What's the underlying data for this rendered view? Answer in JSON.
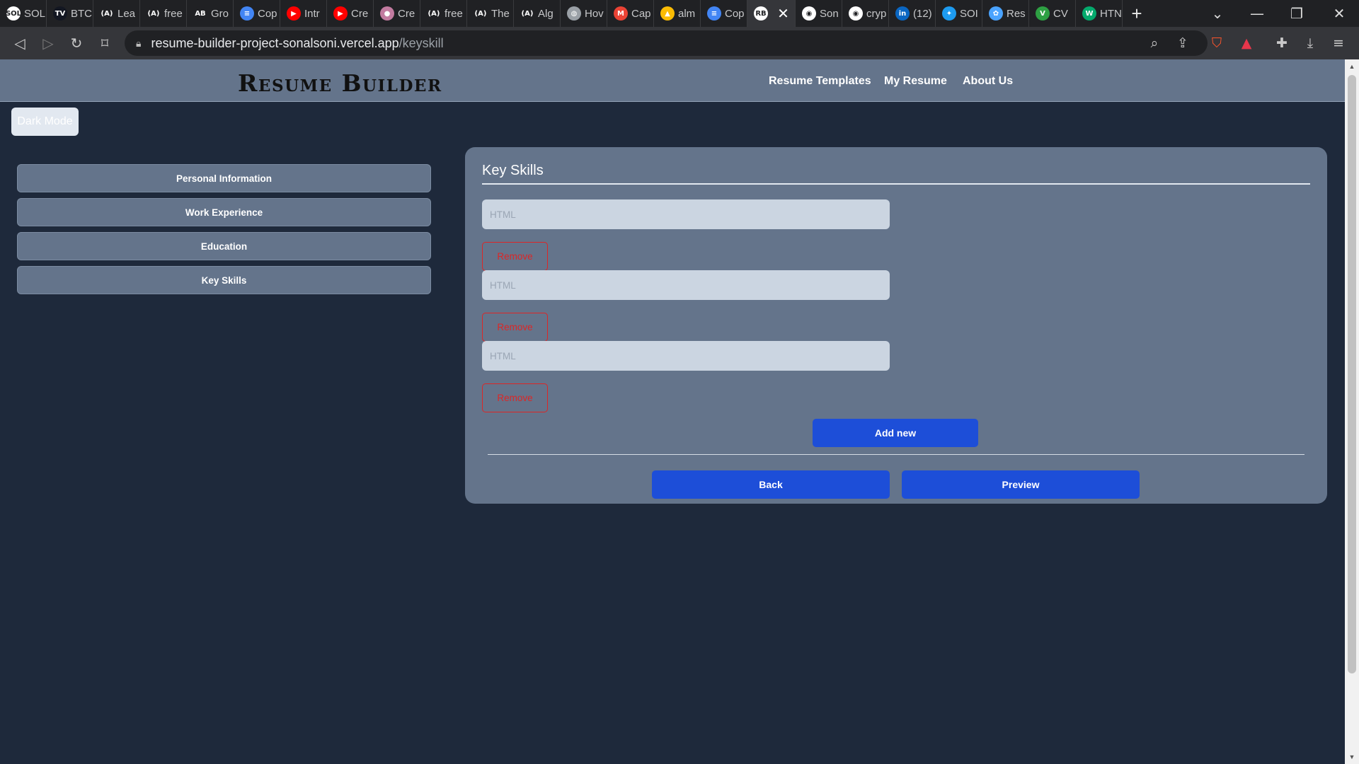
{
  "browser": {
    "tabs": [
      {
        "label": "SOL",
        "icon": "SOL",
        "color": "#ffffff"
      },
      {
        "label": "BTC",
        "icon": "TV",
        "color": "#131722"
      },
      {
        "label": "Lea",
        "icon": "(A)",
        "color": "#202124"
      },
      {
        "label": "free",
        "icon": "(A)",
        "color": "#202124"
      },
      {
        "label": "Gro",
        "icon": "AB",
        "color": "#202124"
      },
      {
        "label": "Cop",
        "icon": "≡",
        "color": "#4285f4"
      },
      {
        "label": "Intr",
        "icon": "▶",
        "color": "#ff0000"
      },
      {
        "label": "Cre",
        "icon": "▶",
        "color": "#ff0000"
      },
      {
        "label": "Cre",
        "icon": "●",
        "color": "#c27ba0"
      },
      {
        "label": "free",
        "icon": "(A)",
        "color": "#202124"
      },
      {
        "label": "The",
        "icon": "(A)",
        "color": "#202124"
      },
      {
        "label": "Alg",
        "icon": "(A)",
        "color": "#202124"
      },
      {
        "label": "Hov",
        "icon": "◍",
        "color": "#9aa0a6"
      },
      {
        "label": "Cap",
        "icon": "M",
        "color": "#ea4335"
      },
      {
        "label": "alm",
        "icon": "▲",
        "color": "#fbbc04"
      },
      {
        "label": "Cop",
        "icon": "≡",
        "color": "#4285f4"
      },
      {
        "label": "✕",
        "icon": "RB",
        "color": "#ffffff",
        "active": true
      },
      {
        "label": "Son",
        "icon": "◉",
        "color": "#ffffff"
      },
      {
        "label": "cryp",
        "icon": "◉",
        "color": "#ffffff"
      },
      {
        "label": "(12)",
        "icon": "in",
        "color": "#0a66c2"
      },
      {
        "label": "SOI",
        "icon": "✦",
        "color": "#1d9bf0"
      },
      {
        "label": "Res",
        "icon": "✿",
        "color": "#4aa3ff"
      },
      {
        "label": "CV",
        "icon": "V",
        "color": "#2ea043"
      },
      {
        "label": "HTN",
        "icon": "W",
        "color": "#04aa6d"
      }
    ],
    "new_tab": "+",
    "url_host": "resume-builder-project-sonalsoni.vercel.app",
    "url_path": "/keyskill"
  },
  "header": {
    "brand": "Resume Builder",
    "nav": [
      "Resume Templates",
      "My Resume",
      "About Us"
    ]
  },
  "dark_mode_label": "Dark Mode",
  "sidebar": {
    "items": [
      "Personal Information",
      "Work Experience",
      "Education",
      "Key Skills"
    ]
  },
  "card": {
    "title": "Key Skills",
    "skills": [
      {
        "value": "",
        "placeholder": "HTML"
      },
      {
        "value": "",
        "placeholder": "HTML"
      },
      {
        "value": "",
        "placeholder": "HTML"
      }
    ],
    "remove_label": "Remove",
    "add_label": "Add new",
    "back_label": "Back",
    "preview_label": "Preview"
  },
  "colors": {
    "page_bg": "#1e293b",
    "header_bg": "#64748b",
    "primary": "#1d4ed8",
    "danger": "#dc2626"
  }
}
